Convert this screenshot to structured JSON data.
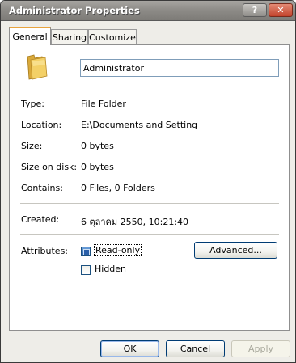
{
  "window": {
    "title": "Administrator Properties",
    "help_glyph": "?",
    "close_glyph": "✕"
  },
  "tabs": [
    {
      "label": "General",
      "active": true
    },
    {
      "label": "Sharing",
      "active": false
    },
    {
      "label": "Customize",
      "active": false
    }
  ],
  "general": {
    "icon": "folder-icon",
    "name_value": "Administrator",
    "properties": [
      {
        "label": "Type:",
        "value": "File Folder"
      },
      {
        "label": "Location:",
        "value": "E:\\Documents and Setting"
      },
      {
        "label": "Size:",
        "value": "0 bytes"
      },
      {
        "label": "Size on disk:",
        "value": "0 bytes"
      },
      {
        "label": "Contains:",
        "value": "0 Files, 0 Folders"
      }
    ],
    "created_label": "Created:",
    "created_value": "6 ตุลาคม 2550, 10:21:40",
    "attributes_label": "Attributes:",
    "readonly_label": "Read-only",
    "readonly_state": "indeterminate",
    "hidden_label": "Hidden",
    "hidden_checked": false,
    "advanced_label": "Advanced..."
  },
  "footer": {
    "ok_label": "OK",
    "cancel_label": "Cancel",
    "apply_label": "Apply",
    "apply_enabled": false
  }
}
